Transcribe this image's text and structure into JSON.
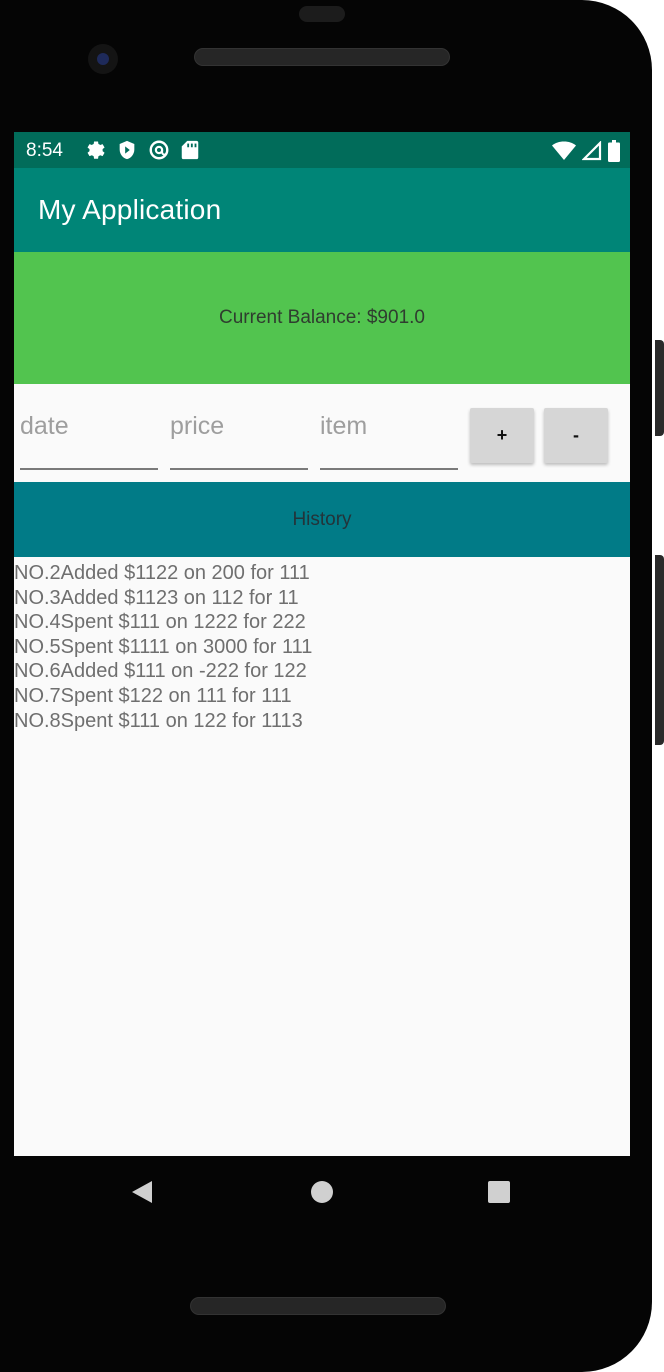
{
  "status_bar": {
    "time": "8:54",
    "left_icons": [
      "gear-icon",
      "shield-play-icon",
      "at-sign-icon",
      "sd-card-icon"
    ],
    "right_icons": [
      "wifi-icon",
      "cell-signal-icon",
      "battery-icon"
    ]
  },
  "app_bar": {
    "title": "My Application",
    "color": "#008577"
  },
  "balance": {
    "text": "Current Balance: $901.0",
    "color": "#52c44f"
  },
  "form": {
    "date_placeholder": "date",
    "price_placeholder": "price",
    "item_placeholder": "item",
    "add_label": "+",
    "subtract_label": "-"
  },
  "history": {
    "header": "History",
    "header_color": "#017b87",
    "entries": [
      "NO.2Added $1122 on 200 for 111",
      "NO.3Added $1123 on 112 for 11",
      "NO.4Spent $111 on 1222 for 222",
      "NO.5Spent $1111 on 3000 for 111",
      "NO.6Added $111 on -222 for 122",
      "NO.7Spent $122 on 111 for 111",
      "NO.8Spent $111 on 122 for 1113"
    ]
  },
  "nav_bar": {
    "icons": [
      "back-icon",
      "home-icon",
      "recents-icon"
    ]
  }
}
